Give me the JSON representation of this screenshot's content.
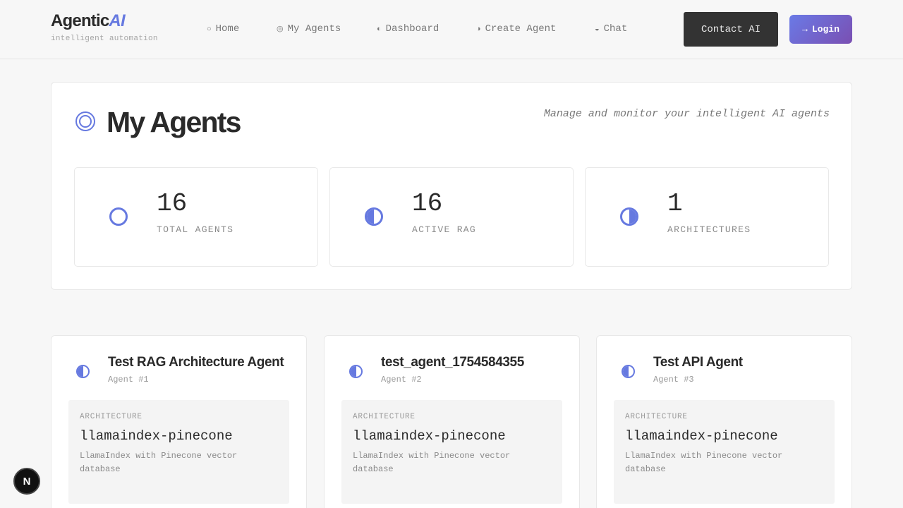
{
  "brand": {
    "name": "Agentic",
    "accent": "AI",
    "tagline": "intelligent automation"
  },
  "nav": [
    {
      "icon": "○",
      "label": "Home"
    },
    {
      "icon": "◎",
      "label": "My Agents"
    },
    {
      "icon": "◐",
      "label": "Dashboard"
    },
    {
      "icon": "◑",
      "label": "Create Agent"
    },
    {
      "icon": "◒",
      "label": "Chat"
    }
  ],
  "header_buttons": {
    "contact": "Contact AI",
    "login_icon": "→",
    "login": "Login"
  },
  "overview": {
    "title": "My Agents",
    "subtitle": "Manage and monitor your intelligent AI agents",
    "stats": [
      {
        "value": "16",
        "label": "TOTAL AGENTS",
        "icon": "circle-outline-icon"
      },
      {
        "value": "16",
        "label": "ACTIVE RAG",
        "icon": "half-circle-left-icon"
      },
      {
        "value": "1",
        "label": "ARCHITECTURES",
        "icon": "half-circle-right-icon"
      }
    ]
  },
  "agents": [
    {
      "name": "Test RAG Architecture Agent",
      "number": "Agent #1",
      "arch_label": "ARCHITECTURE",
      "arch": "llamaindex-pinecone",
      "desc": "LlamaIndex with Pinecone vector database"
    },
    {
      "name": "test_agent_1754584355",
      "number": "Agent #2",
      "arch_label": "ARCHITECTURE",
      "arch": "llamaindex-pinecone",
      "desc": "LlamaIndex with Pinecone vector database"
    },
    {
      "name": "Test API Agent",
      "number": "Agent #3",
      "arch_label": "ARCHITECTURE",
      "arch": "llamaindex-pinecone",
      "desc": "LlamaIndex with Pinecone vector database"
    }
  ],
  "badge": "N",
  "colors": {
    "accent": "#6679e0",
    "dark_button": "#333333",
    "login_gradient_start": "#6a7ae6",
    "login_gradient_end": "#7a4fb2"
  }
}
